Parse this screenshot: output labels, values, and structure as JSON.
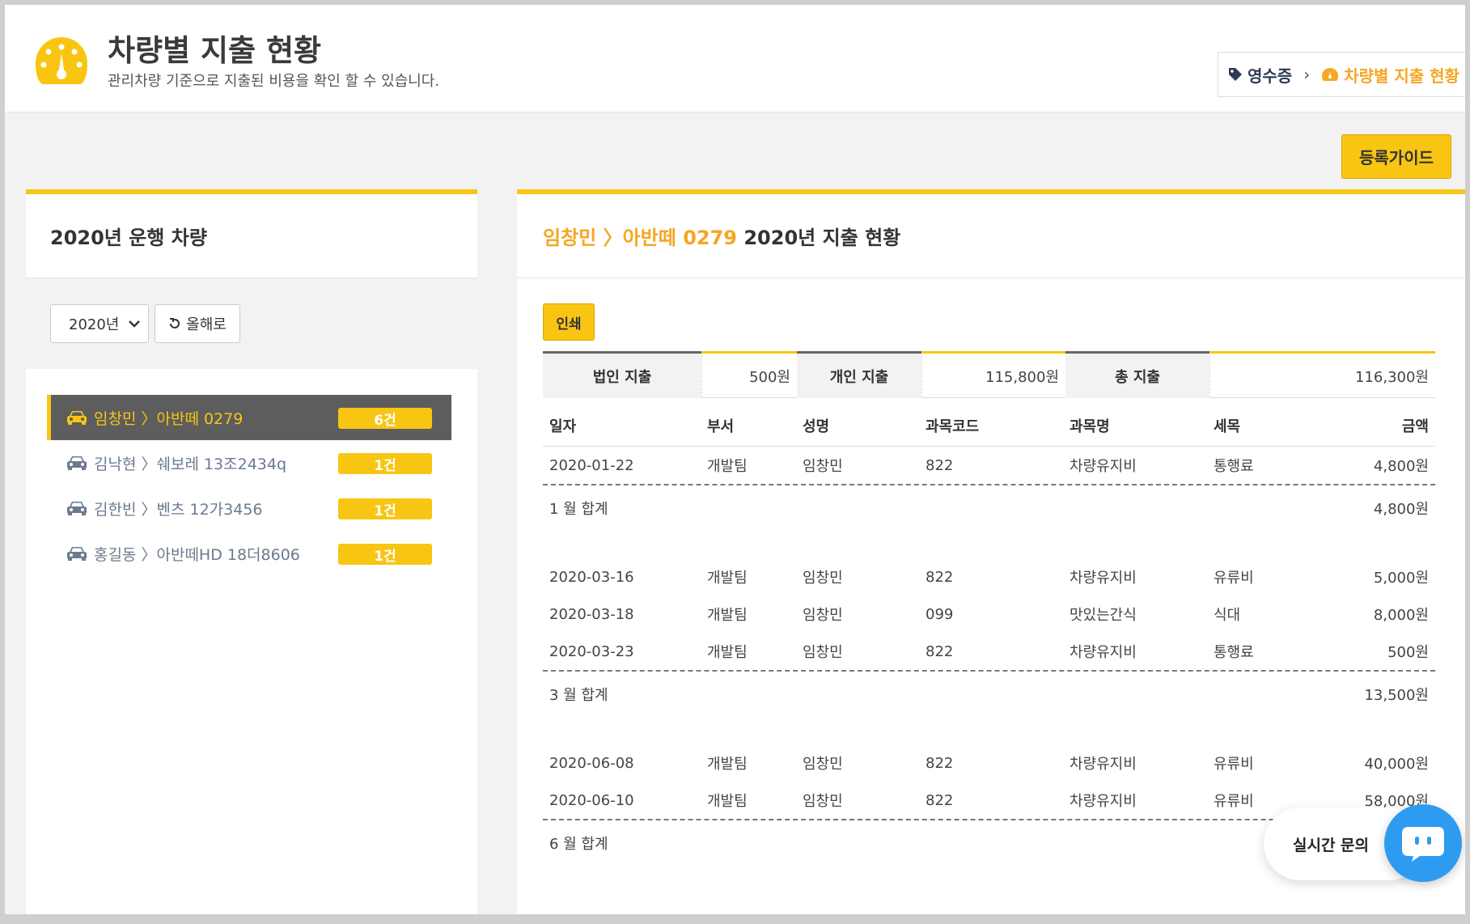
{
  "header": {
    "title": "차량별 지출 현황",
    "subtitle": "관리차량 기준으로 지출된 비용을 확인 할 수 있습니다.",
    "breadcrumb": [
      "영수증",
      "차량별 지출 현황"
    ]
  },
  "actions": {
    "guide_label": "등록가이드"
  },
  "left_panel": {
    "title": "2020년 운행 차량",
    "year_select": "2020년",
    "this_year_label": "올해로",
    "vehicles": [
      {
        "label": "임창민 〉아반떼 0279",
        "count": "6건",
        "active": true
      },
      {
        "label": "김낙현 〉쉐보레 13조2434q",
        "count": "1건",
        "active": false
      },
      {
        "label": "김한빈 〉벤츠 12가3456",
        "count": "1건",
        "active": false
      },
      {
        "label": "홍길동 〉아반떼HD 18더8606",
        "count": "1건",
        "active": false
      }
    ]
  },
  "right_panel": {
    "title_highlight": "임창민 〉아반떼 0279",
    "title_rest": " 2020년 지출 현황",
    "print_label": "인쇄",
    "summary": {
      "corp_label": "법인 지출",
      "corp_value": "500원",
      "personal_label": "개인 지출",
      "personal_value": "115,800원",
      "total_label": "총 지출",
      "total_value": "116,300원"
    },
    "columns": [
      "일자",
      "부서",
      "성명",
      "과목코드",
      "과목명",
      "세목",
      "금액"
    ],
    "groups": [
      {
        "rows": [
          [
            "2020-01-22",
            "개발팀",
            "임창민",
            "822",
            "차량유지비",
            "통행료",
            "4,800원"
          ]
        ],
        "subtotal_label": "1 월 합계",
        "subtotal_value": "4,800원"
      },
      {
        "rows": [
          [
            "2020-03-16",
            "개발팀",
            "임창민",
            "822",
            "차량유지비",
            "유류비",
            "5,000원"
          ],
          [
            "2020-03-18",
            "개발팀",
            "임창민",
            "099",
            "맛있는간식",
            "식대",
            "8,000원"
          ],
          [
            "2020-03-23",
            "개발팀",
            "임창민",
            "822",
            "차량유지비",
            "통행료",
            "500원"
          ]
        ],
        "subtotal_label": "3 월 합계",
        "subtotal_value": "13,500원"
      },
      {
        "rows": [
          [
            "2020-06-08",
            "개발팀",
            "임창민",
            "822",
            "차량유지비",
            "유류비",
            "40,000원"
          ],
          [
            "2020-06-10",
            "개발팀",
            "임창민",
            "822",
            "차량유지비",
            "유류비",
            "58,000원"
          ]
        ],
        "subtotal_label": "6 월 합계",
        "subtotal_value": ""
      }
    ]
  },
  "chat": {
    "label": "실시간 문의"
  },
  "colors": {
    "accent": "#f8c513",
    "highlight": "#f5a623",
    "chat": "#2d9bf0",
    "active_bg": "#5d5d5d"
  }
}
